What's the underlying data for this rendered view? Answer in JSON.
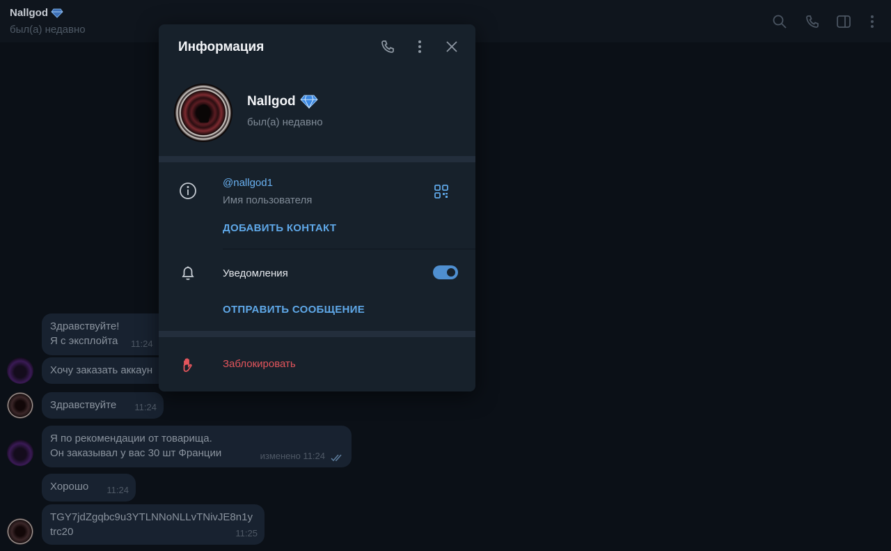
{
  "header": {
    "title": "Nallgod",
    "status": "был(а) недавно",
    "icons": [
      "search-icon",
      "phone-icon",
      "sidebar-icon",
      "more-icon"
    ]
  },
  "messages": [
    {
      "lines": [
        "Здравствуйте!",
        "Я с эксплойта"
      ],
      "time": "11:24",
      "sender": "me"
    },
    {
      "lines": [
        "Хочу заказать аккаун"
      ],
      "time": "",
      "sender": "me"
    },
    {
      "lines": [
        "Здравствуйте"
      ],
      "time": "11:24",
      "sender": "other"
    },
    {
      "lines": [
        "Я по рекомендации от товарища.",
        "Он заказывал у вас 30 шт Франции"
      ],
      "time": "изменено 11:24",
      "sender": "me"
    },
    {
      "lines": [
        "Хорошо"
      ],
      "time": "11:24",
      "sender": "other"
    },
    {
      "lines": [
        "TGY7jdZgqbc9u3YTLNNoNLLvTNivJE8n1y",
        "trc20"
      ],
      "time": "11:25",
      "sender": "other"
    }
  ],
  "panel": {
    "title": "Информация",
    "name": "Nallgod",
    "status": "был(а) недавно",
    "username": "@nallgod1",
    "username_label": "Имя пользователя",
    "add_contact": "ДОБАВИТЬ КОНТАКТ",
    "notifications_label": "Уведомления",
    "notifications_on": true,
    "send_message": "ОТПРАВИТЬ СООБЩЕНИЕ",
    "block": "Заблокировать"
  },
  "colors": {
    "accent": "#6ab2f2",
    "danger": "#e3555c",
    "panel_bg": "#17212b",
    "toggle": "#4f8fd0"
  }
}
